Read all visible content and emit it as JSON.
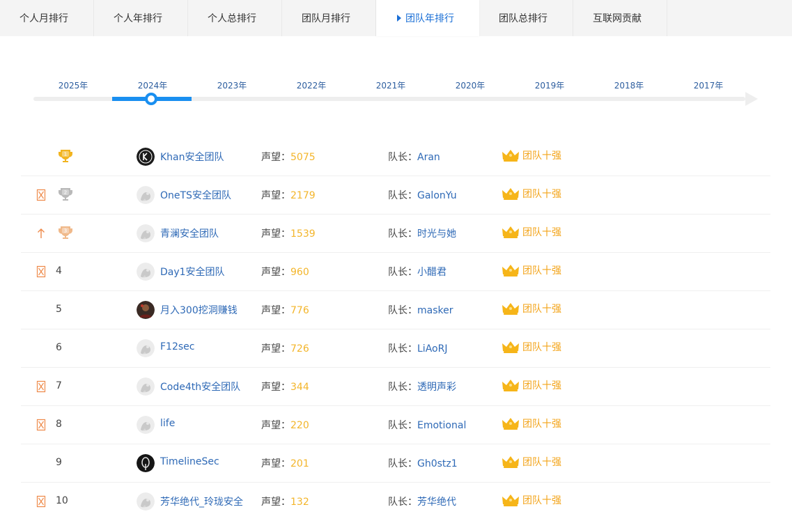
{
  "tabs": [
    {
      "label": "个人月排行",
      "active": false
    },
    {
      "label": "个人年排行",
      "active": false
    },
    {
      "label": "个人总排行",
      "active": false
    },
    {
      "label": "团队月排行",
      "active": false
    },
    {
      "label": "团队年排行",
      "active": true
    },
    {
      "label": "团队总排行",
      "active": false
    },
    {
      "label": "互联网贡献",
      "active": false
    }
  ],
  "timeline": {
    "years": [
      "2025年",
      "2024年",
      "2023年",
      "2022年",
      "2021年",
      "2020年",
      "2019年",
      "2018年",
      "2017年"
    ],
    "selected": "2024年"
  },
  "labels": {
    "reputation": "声望：",
    "leader": "队长：",
    "badge": "团队十强"
  },
  "colors": {
    "accent": "#1a8ff0",
    "link": "#2e69b6",
    "reputation_value": "#f3b52a",
    "badge": "#f3a41a",
    "trend": "#ee8a4a"
  },
  "rows": [
    {
      "rank": "1",
      "trophy": "gold",
      "trend": "none",
      "avatar": "k-logo",
      "team": "Khan安全团队",
      "reputation": "5075",
      "leader": "Aran"
    },
    {
      "rank": "2",
      "trophy": "silver",
      "trend": "flag",
      "avatar": "default",
      "team": "OneTS安全团队",
      "reputation": "2179",
      "leader": "GalonYu"
    },
    {
      "rank": "3",
      "trophy": "bronze",
      "trend": "up",
      "avatar": "default",
      "team": "青澜安全团队",
      "reputation": "1539",
      "leader": "时光与她"
    },
    {
      "rank": "4",
      "trophy": "none",
      "trend": "flag",
      "avatar": "default",
      "team": "Day1安全团队",
      "reputation": "960",
      "leader": "小醋君"
    },
    {
      "rank": "5",
      "trophy": "none",
      "trend": "none",
      "avatar": "photo",
      "team": "月入300挖洞赚钱",
      "reputation": "776",
      "leader": "masker"
    },
    {
      "rank": "6",
      "trophy": "none",
      "trend": "none",
      "avatar": "default",
      "team": "F12sec",
      "reputation": "726",
      "leader": "LiAoRJ"
    },
    {
      "rank": "7",
      "trophy": "none",
      "trend": "flag",
      "avatar": "default",
      "team": "Code4th安全团队",
      "reputation": "344",
      "leader": "透明声彩"
    },
    {
      "rank": "8",
      "trophy": "none",
      "trend": "flag",
      "avatar": "default",
      "team": "life",
      "reputation": "220",
      "leader": "Emotional"
    },
    {
      "rank": "9",
      "trophy": "none",
      "trend": "none",
      "avatar": "q-logo",
      "team": "TimelineSec",
      "reputation": "201",
      "leader": "Gh0stz1"
    },
    {
      "rank": "10",
      "trophy": "none",
      "trend": "flag",
      "avatar": "default",
      "team": "芳华绝代_玲珑安全",
      "reputation": "132",
      "leader": "芳华绝代"
    }
  ]
}
